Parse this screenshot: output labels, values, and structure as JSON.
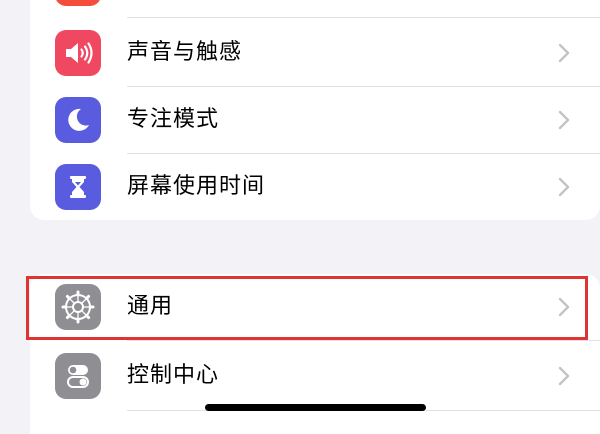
{
  "settings": {
    "group_top": [
      {
        "label": "",
        "icon": "red-app-icon",
        "color": "#f44e3b"
      },
      {
        "label": "声音与触感",
        "icon": "speaker-wave-icon",
        "color": "#ef4860"
      },
      {
        "label": "专注模式",
        "icon": "moon-icon",
        "color": "#5a5ce0"
      },
      {
        "label": "屏幕使用时间",
        "icon": "hourglass-icon",
        "color": "#5a5ce0"
      }
    ],
    "group_bottom": [
      {
        "label": "通用",
        "icon": "gear-icon",
        "color": "#8e8e93",
        "highlighted": true
      },
      {
        "label": "控制中心",
        "icon": "toggle-switches-icon",
        "color": "#8e8e93"
      }
    ]
  },
  "colors": {
    "background": "#f2f2f7",
    "card": "#ffffff",
    "chevron": "#c4c4c7",
    "highlight": "#e03434"
  }
}
